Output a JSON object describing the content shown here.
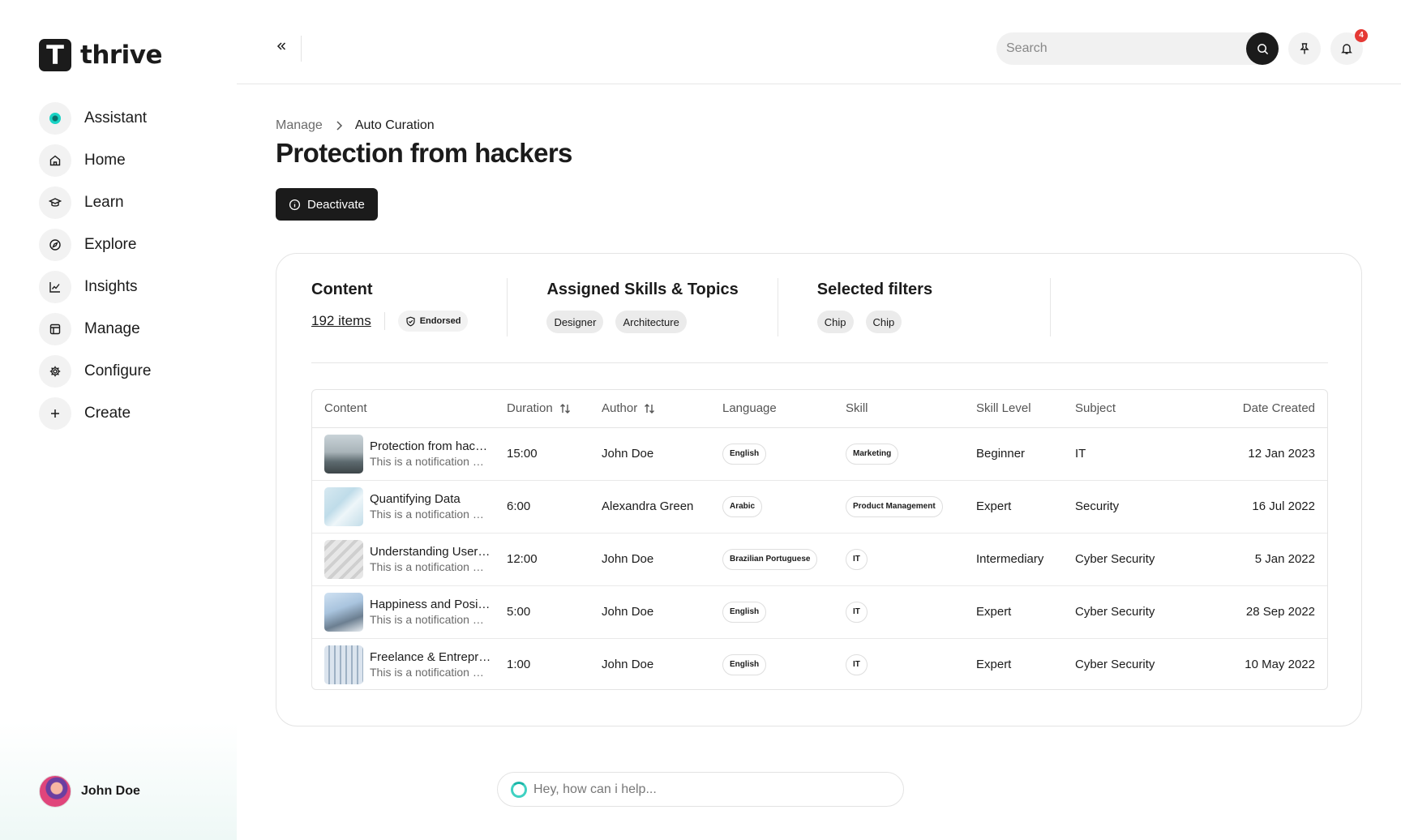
{
  "brand": {
    "logo_letter": "T",
    "name": "thrive"
  },
  "sidebar": {
    "items": [
      {
        "label": "Assistant",
        "icon": "assistant-dot-icon"
      },
      {
        "label": "Home",
        "icon": "home-icon"
      },
      {
        "label": "Learn",
        "icon": "graduation-cap-icon"
      },
      {
        "label": "Explore",
        "icon": "compass-icon"
      },
      {
        "label": "Insights",
        "icon": "line-chart-icon"
      },
      {
        "label": "Manage",
        "icon": "layout-icon"
      },
      {
        "label": "Configure",
        "icon": "gear-icon"
      },
      {
        "label": "Create",
        "icon": "plus-icon"
      }
    ],
    "user": {
      "name": "John Doe"
    }
  },
  "topbar": {
    "search_placeholder": "Search",
    "notification_count": "4"
  },
  "breadcrumb": {
    "parent": "Manage",
    "current": "Auto Curation"
  },
  "page": {
    "title": "Protection from hackers",
    "deactivate_label": "Deactivate"
  },
  "summary": {
    "content": {
      "title": "Content",
      "items_link": "192 items",
      "endorsed_label": "Endorsed"
    },
    "skills": {
      "title": "Assigned Skills & Topics",
      "chips": [
        "Designer",
        "Architecture"
      ]
    },
    "filters": {
      "title": "Selected filters",
      "chips": [
        "Chip",
        "Chip"
      ]
    }
  },
  "table": {
    "headers": {
      "content": "Content",
      "duration": "Duration",
      "author": "Author",
      "language": "Language",
      "skill": "Skill",
      "skill_level": "Skill Level",
      "subject": "Subject",
      "date_created": "Date Created"
    },
    "rows": [
      {
        "title": "Protection from hackers",
        "subtitle": "This is a notification message",
        "duration": "15:00",
        "author": "John Doe",
        "language": "English",
        "skill": "Marketing",
        "level": "Beginner",
        "subject": "IT",
        "date": "12 Jan 2023"
      },
      {
        "title": "Quantifying Data",
        "subtitle": "This is a notification message",
        "duration": "6:00",
        "author": "Alexandra Green",
        "language": "Arabic",
        "skill": "Product Management",
        "level": "Expert",
        "subject": "Security",
        "date": "16 Jul 2022"
      },
      {
        "title": "Understanding User Research",
        "subtitle": "This is a notification message",
        "duration": "12:00",
        "author": "John Doe",
        "language": "Brazilian Portuguese",
        "skill": "IT",
        "level": "Intermediary",
        "subject": "Cyber Security",
        "date": "5 Jan 2022"
      },
      {
        "title": "Happiness and Positive Psychology",
        "subtitle": "This is a notification message",
        "duration": "5:00",
        "author": "John Doe",
        "language": "English",
        "skill": "IT",
        "level": "Expert",
        "subject": "Cyber Security",
        "date": "28 Sep 2022"
      },
      {
        "title": "Freelance & Entrepreneurship",
        "subtitle": "This is a notification message",
        "duration": "1:00",
        "author": "John Doe",
        "language": "English",
        "skill": "IT",
        "level": "Expert",
        "subject": "Cyber Security",
        "date": "10 May 2022"
      }
    ]
  },
  "assistant": {
    "placeholder": "Hey, how can i help..."
  }
}
